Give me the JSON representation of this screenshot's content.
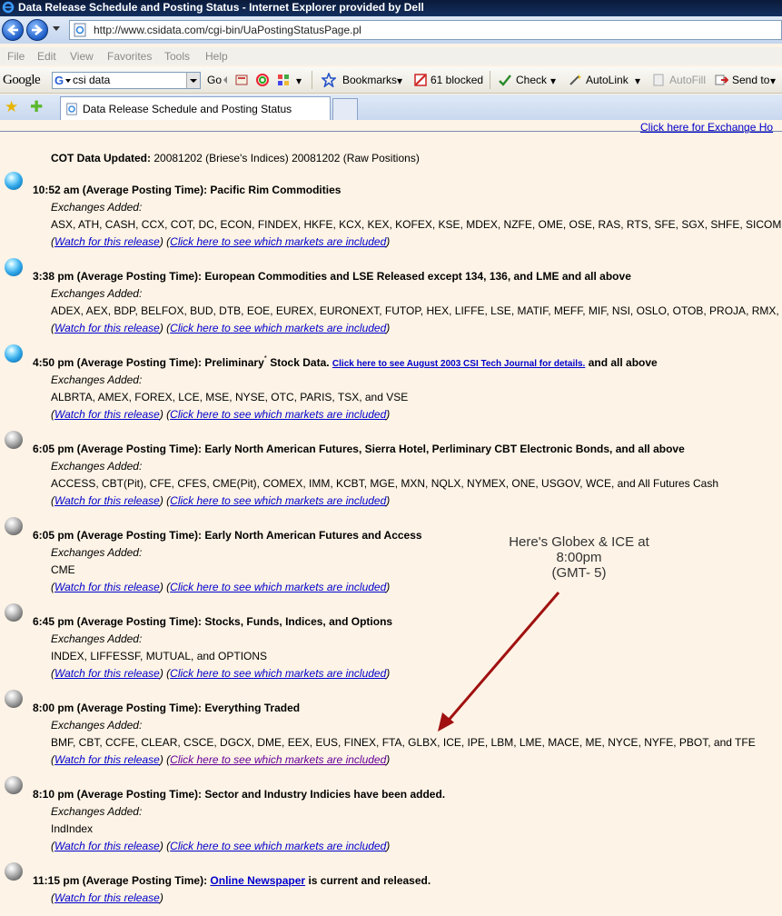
{
  "window": {
    "title": "Data Release Schedule and Posting Status - Internet Explorer provided by Dell"
  },
  "address": {
    "url": "http://www.csidata.com/cgi-bin/UaPostingStatusPage.pl"
  },
  "menu": [
    "File",
    "Edit",
    "View",
    "Favorites",
    "Tools",
    "Help"
  ],
  "google_bar": {
    "logo": "Google",
    "search_value": "csi data",
    "go_label": "Go",
    "bookmarks_label": "Bookmarks",
    "blocked_label": "61 blocked",
    "check_label": "Check",
    "autolink_label": "AutoLink",
    "autofill_label": "AutoFill",
    "sendto_label": "Send to"
  },
  "tab": {
    "title": "Data Release Schedule and Posting Status"
  },
  "page": {
    "exchange_link": "Click here for Exchange Ho",
    "cot_label": "COT Data Updated:",
    "cot_value": "20081202 (Briese's Indices) 20081202 (Raw Positions)",
    "exchanges_added_label": "Exchanges Added:",
    "watch_label": "Watch for this release",
    "markets_label": "Click here to see which markets are included",
    "annotation": [
      "Here's Globex & ICE at",
      "8:00pm",
      "(GMT- 5)"
    ],
    "releases": [
      {
        "ball": "blue",
        "title": "10:52 am (Average Posting Time): Pacific Rim Commodities",
        "exchanges": "ASX, ATH, CASH, CCX, COT, DC, ECON, FINDEX, HKFE, KCX, KEX, KOFEX, KSE, MDEX, NZFE, OME, OSE, RAS, RTS, SFE, SGX, SHFE, SICOM, SIM"
      },
      {
        "ball": "blue",
        "title": "3:38 pm (Average Posting Time): European Commodities and LSE Released except 134, 136, and LME and all above",
        "exchanges": "ADEX, AEX, BDP, BELFOX, BUD, DTB, EOE, EUREX, EURONEXT, FUTOP, HEX, LIFFE, LSE, MATIF, MEFF, MIF, NSI, OSLO, OTOB, PROJA, RMX, SAF"
      },
      {
        "ball": "blue",
        "title_a": "4:50 pm (Average Posting Time): Preliminary",
        "title_sup": "*",
        "title_b": "Stock Data.",
        "title_link": "Click here to see August 2003 CSI Tech Journal for details.",
        "title_c": "and all above",
        "exchanges": "ALBRTA, AMEX, FOREX, LCE, MSE, NYSE, OTC, PARIS, TSX, and VSE"
      },
      {
        "ball": "gray",
        "title": "6:05 pm (Average Posting Time): Early North American Futures, Sierra Hotel, Perliminary CBT Electronic Bonds, and all above",
        "exchanges": "ACCESS, CBT(Pit), CFE, CFES, CME(Pit), COMEX, IMM, KCBT, MGE, MXN, NQLX, NYMEX, ONE, USGOV, WCE, and All Futures Cash"
      },
      {
        "ball": "gray",
        "title": "6:05 pm (Average Posting Time): Early North American Futures and Access",
        "exchanges": "CME"
      },
      {
        "ball": "gray",
        "title": "6:45 pm (Average Posting Time): Stocks, Funds, Indices, and Options",
        "exchanges": "INDEX, LIFFESSF, MUTUAL, and OPTIONS"
      },
      {
        "ball": "gray",
        "title": "8:00 pm (Average Posting Time): Everything Traded",
        "exchanges": "BMF, CBT, CCFE, CLEAR, CSCE, DGCX, DME, EEX, EUS, FINEX, FTA, GLBX, ICE, IPE, LBM, LME, MACE, ME, NYCE, NYFE, PBOT, and TFE"
      },
      {
        "ball": "gray",
        "title": "8:10 pm (Average Posting Time): Sector and Industry Indicies have been added.",
        "exchanges": "IndIndex"
      },
      {
        "ball": "gray",
        "title_a": "11:15 pm (Average Posting Time):",
        "title_link": "Online Newspaper",
        "title_c": "is current and released."
      }
    ]
  }
}
